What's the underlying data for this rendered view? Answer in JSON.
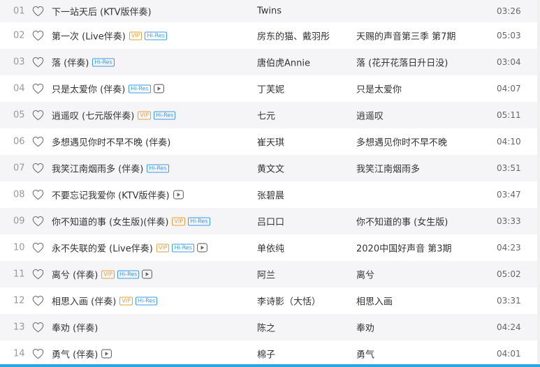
{
  "songs": [
    {
      "index": "01",
      "title": "下一站天后 (KTV版伴奏)",
      "vip": false,
      "hires": false,
      "mv": false,
      "artist": "Twins",
      "album": "",
      "duration": "03:26"
    },
    {
      "index": "02",
      "title": "第一次 (Live伴奏)",
      "vip": true,
      "hires": true,
      "mv": false,
      "artist": "房东的猫、戴羽彤",
      "album": "天赐的声音第三季 第7期",
      "duration": "05:03"
    },
    {
      "index": "03",
      "title": "落 (伴奏)",
      "vip": false,
      "hires": true,
      "mv": false,
      "artist": "唐伯虎Annie",
      "album": "落 (花开花落日升日没)",
      "duration": "03:04"
    },
    {
      "index": "04",
      "title": "只是太爱你 (伴奏)",
      "vip": false,
      "hires": true,
      "mv": true,
      "artist": "丁芙妮",
      "album": "只是太爱你",
      "duration": "04:07"
    },
    {
      "index": "05",
      "title": "逍遥叹 (七元版伴奏)",
      "vip": true,
      "hires": true,
      "mv": false,
      "artist": "七元",
      "album": "逍遥叹",
      "duration": "05:11"
    },
    {
      "index": "06",
      "title": "多想遇见你时不早不晚 (伴奏)",
      "vip": false,
      "hires": false,
      "mv": false,
      "artist": "崔天琪",
      "album": "多想遇见你时不早不晚",
      "duration": "04:10"
    },
    {
      "index": "07",
      "title": "我笑江南烟雨多 (伴奏)",
      "vip": false,
      "hires": true,
      "mv": false,
      "artist": "黄文文",
      "album": "我笑江南烟雨多",
      "duration": "03:51"
    },
    {
      "index": "08",
      "title": "不要忘记我爱你 (KTV版伴奏)",
      "vip": false,
      "hires": false,
      "mv": true,
      "artist": "张碧晨",
      "album": "",
      "duration": "03:47"
    },
    {
      "index": "09",
      "title": "你不知道的事 (女生版)(伴奏)",
      "vip": true,
      "hires": true,
      "mv": false,
      "artist": "吕口口",
      "album": "你不知道的事 (女生版)",
      "duration": "03:33"
    },
    {
      "index": "10",
      "title": "永不失联的爱 (Live伴奏)",
      "vip": true,
      "hires": true,
      "mv": true,
      "artist": "单依纯",
      "album": "2020中国好声音 第3期",
      "duration": "04:23"
    },
    {
      "index": "11",
      "title": "离兮 (伴奏)",
      "vip": true,
      "hires": true,
      "mv": true,
      "artist": "阿兰",
      "album": "离兮",
      "duration": "05:02"
    },
    {
      "index": "12",
      "title": "相思入画 (伴奏)",
      "vip": true,
      "hires": true,
      "mv": false,
      "artist": "李诗影（大恬）",
      "album": "相思入画",
      "duration": "03:31"
    },
    {
      "index": "13",
      "title": "奉劝 (伴奏)",
      "vip": false,
      "hires": false,
      "mv": false,
      "artist": "陈之",
      "album": "奉劝",
      "duration": "04:24"
    },
    {
      "index": "14",
      "title": "勇气 (伴奏)",
      "vip": false,
      "hires": false,
      "mv": true,
      "artist": "棉子",
      "album": "勇气",
      "duration": "04:01"
    }
  ],
  "badges": {
    "vip_label": "VIP",
    "hires_label": "Hi-Res"
  },
  "icons": {
    "like": "heart-outline-icon",
    "mv": "play-video-icon"
  },
  "colors": {
    "row_alt_bg": "#f5f5f7",
    "vip": "#e6a23c",
    "hires": "#3a9be8",
    "accent_bar": "#29a7e1"
  }
}
